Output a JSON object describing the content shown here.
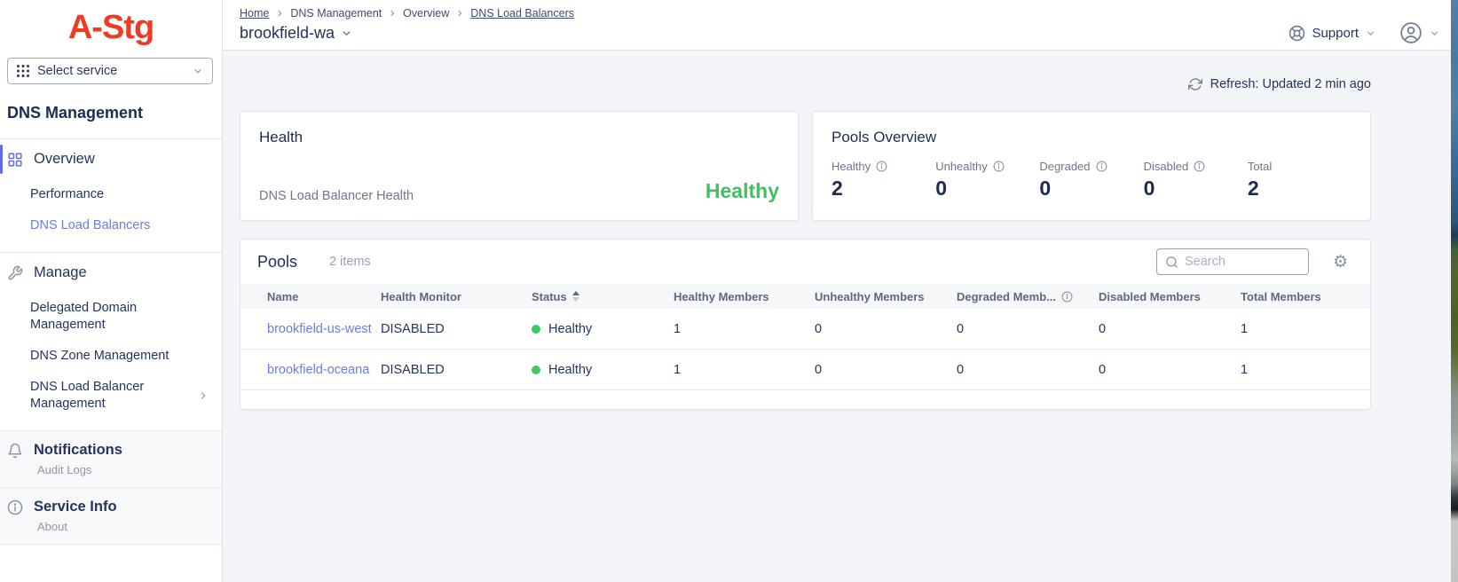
{
  "app": {
    "logo": "A-Stg",
    "select_service_label": "Select service"
  },
  "sidebar": {
    "title": "DNS Management",
    "overview": {
      "label": "Overview",
      "items": [
        {
          "label": "Performance"
        },
        {
          "label": "DNS Load Balancers"
        }
      ]
    },
    "manage": {
      "label": "Manage",
      "items": [
        {
          "label": "Delegated Domain Management"
        },
        {
          "label": "DNS Zone Management"
        },
        {
          "label": "DNS Load Balancer Management"
        }
      ]
    },
    "notifications": {
      "label": "Notifications",
      "sub": "Audit Logs"
    },
    "service_info": {
      "label": "Service Info",
      "sub": "About"
    }
  },
  "header": {
    "breadcrumbs": [
      "Home",
      "DNS Management",
      "Overview",
      "DNS Load Balancers"
    ],
    "page_title": "brookfield-wa",
    "support_label": "Support"
  },
  "refresh": {
    "label": "Refresh: Updated 2 min ago"
  },
  "health_card": {
    "title": "Health",
    "metric_label": "DNS Load Balancer Health",
    "metric_value": "Healthy"
  },
  "pools_overview": {
    "title": "Pools Overview",
    "stats": [
      {
        "label": "Healthy",
        "value": "2",
        "has_info": true
      },
      {
        "label": "Unhealthy",
        "value": "0",
        "has_info": true
      },
      {
        "label": "Degraded",
        "value": "0",
        "has_info": true
      },
      {
        "label": "Disabled",
        "value": "0",
        "has_info": true
      },
      {
        "label": "Total",
        "value": "2",
        "has_info": false
      }
    ]
  },
  "pools": {
    "title": "Pools",
    "count_label": "2 items",
    "search_placeholder": "Search",
    "columns": [
      {
        "label": "Name"
      },
      {
        "label": "Health Monitor"
      },
      {
        "label": "Status",
        "sortable": true
      },
      {
        "label": "Healthy Members"
      },
      {
        "label": "Unhealthy Members"
      },
      {
        "label": "Degraded Memb...",
        "has_info": true
      },
      {
        "label": "Disabled Members"
      },
      {
        "label": "Total Members"
      }
    ],
    "rows": [
      {
        "name": "brookfield-us-west",
        "health_monitor": "DISABLED",
        "status": "Healthy",
        "healthy": "1",
        "unhealthy": "0",
        "degraded": "0",
        "disabled": "0",
        "total": "1"
      },
      {
        "name": "brookfield-oceana",
        "health_monitor": "DISABLED",
        "status": "Healthy",
        "healthy": "1",
        "unhealthy": "0",
        "degraded": "0",
        "disabled": "0",
        "total": "1"
      }
    ]
  },
  "icons": {
    "settings_gear": "⚙"
  },
  "colors": {
    "logo_red": "#ee3b26",
    "accent_indigo": "#6b7ce4",
    "healthy_green": "#3ec161",
    "status_dot_green": "#41c964",
    "navy_text": "#1c2b55"
  }
}
